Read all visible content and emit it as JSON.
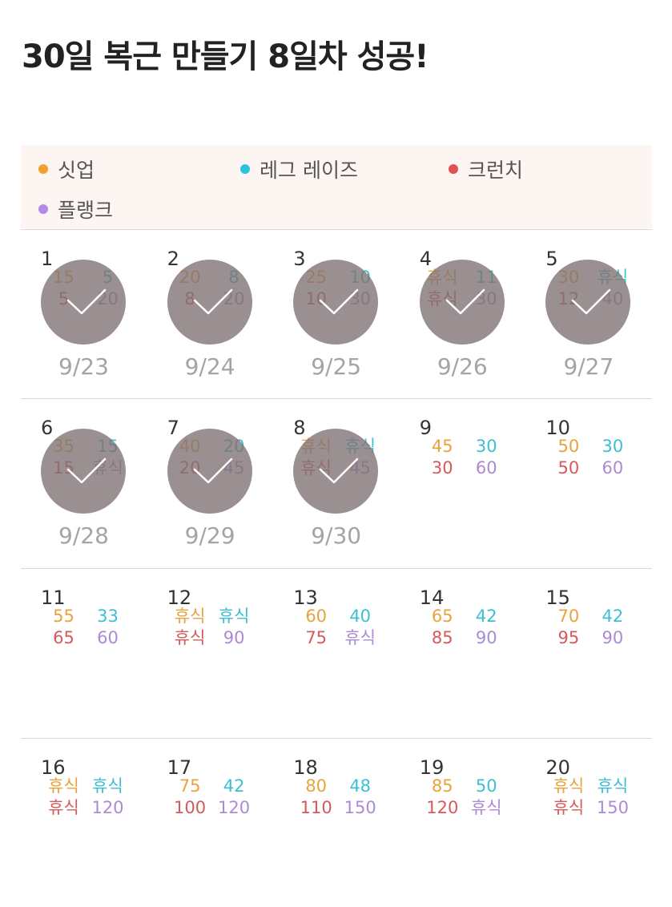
{
  "title": "30일 복근 만들기 8일차 성공!",
  "legend": [
    {
      "label": "싯업",
      "color": "#f0a22e",
      "icon": "orange-dot-icon"
    },
    {
      "label": "레그 레이즈",
      "color": "#2bc4e0",
      "icon": "cyan-dot-icon"
    },
    {
      "label": "크런치",
      "color": "#e3504f",
      "icon": "red-dot-icon"
    },
    {
      "label": "플랭크",
      "color": "#b28ae8",
      "icon": "purple-dot-icon"
    }
  ],
  "days": [
    {
      "day": "1",
      "situp": "15",
      "leg": "5",
      "crunch": "5",
      "plank": "20",
      "done": true,
      "date": "9/23"
    },
    {
      "day": "2",
      "situp": "20",
      "leg": "8",
      "crunch": "8",
      "plank": "20",
      "done": true,
      "date": "9/24"
    },
    {
      "day": "3",
      "situp": "25",
      "leg": "10",
      "crunch": "10",
      "plank": "30",
      "done": true,
      "date": "9/25"
    },
    {
      "day": "4",
      "situp": "휴식",
      "leg": "11",
      "crunch": "휴식",
      "plank": "30",
      "done": true,
      "date": "9/26"
    },
    {
      "day": "5",
      "situp": "30",
      "leg": "휴식",
      "crunch": "12",
      "plank": "40",
      "done": true,
      "date": "9/27"
    },
    {
      "day": "6",
      "situp": "35",
      "leg": "15",
      "crunch": "15",
      "plank": "휴식",
      "done": true,
      "date": "9/28"
    },
    {
      "day": "7",
      "situp": "40",
      "leg": "20",
      "crunch": "20",
      "plank": "45",
      "done": true,
      "date": "9/29"
    },
    {
      "day": "8",
      "situp": "휴식",
      "leg": "휴식",
      "crunch": "휴식",
      "plank": "45",
      "done": true,
      "date": "9/30"
    },
    {
      "day": "9",
      "situp": "45",
      "leg": "30",
      "crunch": "30",
      "plank": "60",
      "done": false,
      "date": ""
    },
    {
      "day": "10",
      "situp": "50",
      "leg": "30",
      "crunch": "50",
      "plank": "60",
      "done": false,
      "date": ""
    },
    {
      "day": "11",
      "situp": "55",
      "leg": "33",
      "crunch": "65",
      "plank": "60",
      "done": false,
      "date": ""
    },
    {
      "day": "12",
      "situp": "휴식",
      "leg": "휴식",
      "crunch": "휴식",
      "plank": "90",
      "done": false,
      "date": ""
    },
    {
      "day": "13",
      "situp": "60",
      "leg": "40",
      "crunch": "75",
      "plank": "휴식",
      "done": false,
      "date": ""
    },
    {
      "day": "14",
      "situp": "65",
      "leg": "42",
      "crunch": "85",
      "plank": "90",
      "done": false,
      "date": ""
    },
    {
      "day": "15",
      "situp": "70",
      "leg": "42",
      "crunch": "95",
      "plank": "90",
      "done": false,
      "date": ""
    },
    {
      "day": "16",
      "situp": "휴식",
      "leg": "휴식",
      "crunch": "휴식",
      "plank": "120",
      "done": false,
      "date": ""
    },
    {
      "day": "17",
      "situp": "75",
      "leg": "42",
      "crunch": "100",
      "plank": "120",
      "done": false,
      "date": ""
    },
    {
      "day": "18",
      "situp": "80",
      "leg": "48",
      "crunch": "110",
      "plank": "150",
      "done": false,
      "date": ""
    },
    {
      "day": "19",
      "situp": "85",
      "leg": "50",
      "crunch": "120",
      "plank": "휴식",
      "done": false,
      "date": ""
    },
    {
      "day": "20",
      "situp": "휴식",
      "leg": "휴식",
      "crunch": "휴식",
      "plank": "150",
      "done": false,
      "date": ""
    }
  ]
}
